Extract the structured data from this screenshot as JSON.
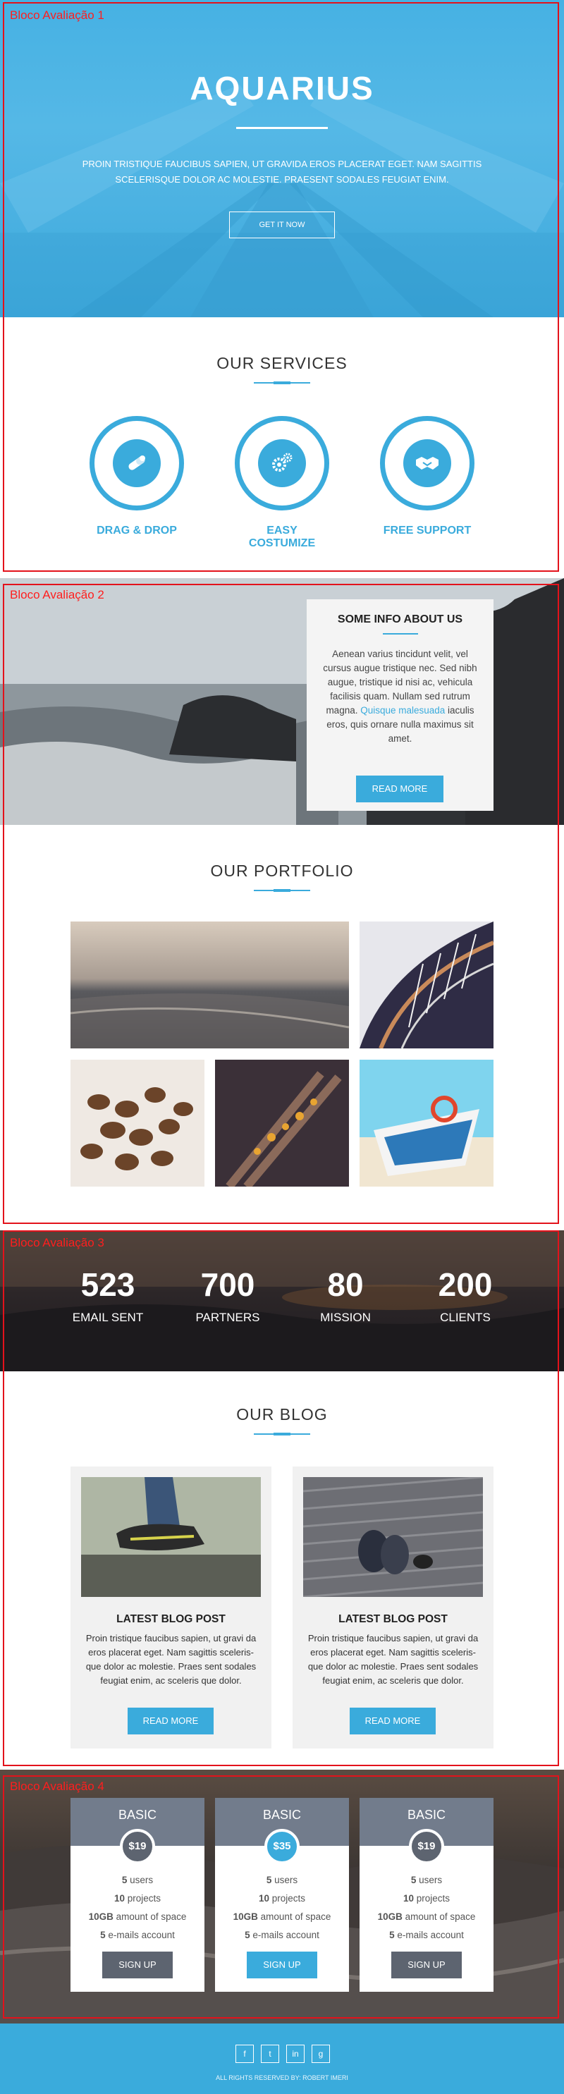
{
  "hero": {
    "title": "AQUARIUS",
    "text": "PROIN TRISTIQUE FAUCIBUS SAPIEN, UT GRAVIDA EROS PLACERAT EGET. NAM SAGITTIS SCELERISQUE DOLOR AC MOLESTIE. PRAESENT SODALES FEUGIAT ENIM.",
    "button": "GET IT NOW"
  },
  "services": {
    "title": "OUR SERVICES",
    "items": [
      {
        "label": "DRAG & DROP",
        "icon": "pills-icon"
      },
      {
        "label": "EASY COSTUMIZE",
        "icon": "gears-icon"
      },
      {
        "label": "FREE SUPPORT",
        "icon": "handshake-icon"
      }
    ]
  },
  "info": {
    "title": "SOME INFO ABOUT US",
    "text_before": "Aenean varius tincidunt velit, vel cursus augue tristique nec. Sed nibh augue, tristique id nisi ac, vehicula facilisis quam. Nullam sed rutrum magna. ",
    "link": "Quisque malesuada",
    "text_after": " iaculis eros, quis ornare nulla maximus sit amet.",
    "button": "READ MORE"
  },
  "portfolio": {
    "title": "OUR PORTFOLIO"
  },
  "stats": [
    {
      "number": "523",
      "label": "EMAIL SENT"
    },
    {
      "number": "700",
      "label": "PARTNERS"
    },
    {
      "number": "80",
      "label": "MISSION"
    },
    {
      "number": "200",
      "label": "CLIENTS"
    }
  ],
  "blog": {
    "title": "OUR BLOG",
    "posts": [
      {
        "title": "LATEST BLOG POST",
        "text": "Proin tristique faucibus sapien, ut gravi da eros placerat eget. Nam sagittis sceleris-que dolor ac molestie. Praes sent sodales feugiat enim, ac sceleris que dolor.",
        "button": "READ MORE"
      },
      {
        "title": "LATEST BLOG POST",
        "text": "Proin tristique faucibus sapien, ut gravi da eros placerat eget. Nam sagittis sceleris-que dolor ac molestie. Praes sent sodales feugiat enim, ac sceleris que dolor.",
        "button": "READ MORE"
      }
    ]
  },
  "pricing": {
    "plans": [
      {
        "name": "BASIC",
        "price": "$19",
        "users_n": "5",
        "users": " users",
        "projects_n": "10",
        "projects": " projects",
        "space_n": "10GB",
        "space": " amount of space",
        "email_n": "5",
        "email": " e-mails account",
        "button": "SIGN UP",
        "button_color": "#5d6470",
        "price_color": "#5d6470"
      },
      {
        "name": "BASIC",
        "price": "$35",
        "users_n": "5",
        "users": " users",
        "projects_n": "10",
        "projects": " projects",
        "space_n": "10GB",
        "space": " amount of space",
        "email_n": "5",
        "email": " e-mails account",
        "button": "SIGN UP",
        "button_color": "#3aabdc",
        "price_color": "#3aabdc"
      },
      {
        "name": "BASIC",
        "price": "$19",
        "users_n": "5",
        "users": " users",
        "projects_n": "10",
        "projects": " projects",
        "space_n": "10GB",
        "space": " amount of space",
        "email_n": "5",
        "email": " e-mails account",
        "button": "SIGN UP",
        "button_color": "#5d6470",
        "price_color": "#5d6470"
      }
    ]
  },
  "footer": {
    "social": [
      {
        "glyph": "f",
        "icon": "facebook-icon"
      },
      {
        "glyph": "t",
        "icon": "twitter-icon"
      },
      {
        "glyph": "in",
        "icon": "linkedin-icon"
      },
      {
        "glyph": "g",
        "icon": "googleplus-icon"
      }
    ],
    "copyright": "ALL RIGHTS RESERVED BY: ROBERT IMERI"
  },
  "annotations": [
    "Bloco Avaliação 1",
    "Bloco Avaliação 2",
    "Bloco Avaliação 3",
    "Bloco Avaliação 4"
  ],
  "colors": {
    "accent": "#3aabdc",
    "frame": "#e3121b",
    "plan_head": "#727c8c"
  }
}
